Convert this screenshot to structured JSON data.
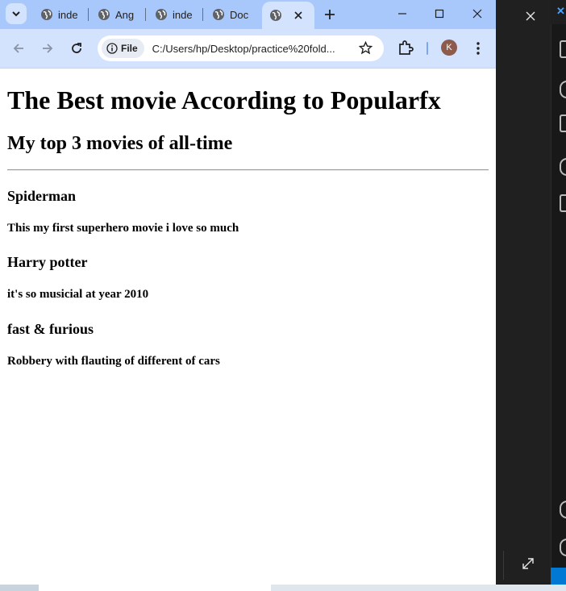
{
  "browser": {
    "tabs": [
      {
        "label": "inde"
      },
      {
        "label": "Ang"
      },
      {
        "label": "inde"
      },
      {
        "label": "Doc"
      },
      {
        "label": ""
      }
    ],
    "active_tab_index": 4,
    "address": {
      "chip_label": "File",
      "url": "C:/Users/hp/Desktop/practice%20fold..."
    },
    "profile_initial": "K"
  },
  "page": {
    "h1": "The Best movie According to Popularfx",
    "h2": "My top 3 movies of all-time",
    "movies": [
      {
        "title": "Spiderman",
        "desc": "This my first superhero movie i love so much"
      },
      {
        "title": "Harry potter",
        "desc": "it's so musicial at year 2010"
      },
      {
        "title": "fast & furious",
        "desc": "Robbery with flauting of different of cars"
      }
    ]
  },
  "colors": {
    "tabstrip": "#a8c7fa",
    "toolbar": "#d3e3fd",
    "avatar": "#8d5b4c",
    "vscode_accent": "#0078d4"
  }
}
